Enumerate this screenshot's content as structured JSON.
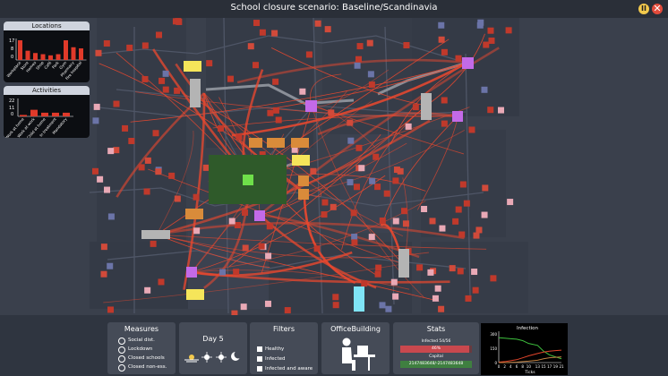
{
  "window": {
    "title": "School closure scenario: Baseline/Scandinavia",
    "pause_icon": "pause-icon",
    "close_icon": "close-icon"
  },
  "locations_chart": {
    "title": "Locations",
    "type": "bar",
    "yticks": [
      "17",
      "8",
      "0"
    ],
    "categories": [
      "Home",
      "Workplace",
      "School",
      "Daycare",
      "Bar",
      "Restaurant",
      "Shop",
      "Park",
      "Other"
    ],
    "display_labels": [
      "Workplace",
      "Store",
      "Homes",
      "Shop",
      "Café",
      "Park",
      "Gym",
      "Pharmacy",
      "Fire hospital"
    ],
    "values": [
      17,
      8,
      6,
      5,
      4,
      5,
      17,
      11,
      10
    ],
    "color": "#e03a2a",
    "ylim": [
      0,
      17
    ]
  },
  "activities_chart": {
    "title": "Activities",
    "type": "bar",
    "yticks": [
      "22",
      "11",
      "0"
    ],
    "categories": [
      "Work at home",
      "Work at work",
      "Child at home",
      "In treatment",
      "Mandatory"
    ],
    "values": [
      2,
      9,
      5,
      5,
      5
    ],
    "color": "#e03a2a",
    "ylim": [
      0,
      22
    ]
  },
  "measures": {
    "title": "Measures",
    "options": [
      "Social dist.",
      "Lockdown",
      "Closed schools",
      "Closed non-ess."
    ]
  },
  "day": {
    "label": "Day 5",
    "phase_icons": [
      "sunrise-icon",
      "sun-icon",
      "sun-icon",
      "moon-icon"
    ]
  },
  "filters": {
    "title": "Filters",
    "options": [
      "Healthy",
      "Infected",
      "Infected and aware"
    ]
  },
  "building": {
    "title": "OfficeBuilding",
    "icon": "office-worker-icon"
  },
  "stats": {
    "title": "Stats",
    "infected_label": "Infected 54/56",
    "bar_label": "46%",
    "capital_label": "Capital",
    "capital_value": "2147483648/-2147483648",
    "infected_fraction": 0.96,
    "colors": {
      "infected": "#c9484e",
      "capital": "#3f7f40"
    }
  },
  "infection_chart": {
    "title": "Infection",
    "type": "line",
    "x": [
      0,
      2,
      4,
      6,
      8,
      10,
      13,
      15,
      17,
      19,
      21
    ],
    "xticks": [
      "0",
      "2",
      "4",
      "6",
      "8",
      "10",
      "13",
      "15",
      "17",
      "19",
      "21"
    ],
    "yticks": [
      "300",
      "150",
      "0"
    ],
    "xlabel": "Ticks",
    "ylim": [
      0,
      300
    ],
    "series": [
      {
        "color": "#3ec13e",
        "values": [
          260,
          255,
          250,
          245,
          230,
          200,
          180,
          120,
          80,
          60,
          40
        ]
      },
      {
        "color": "#e2452b",
        "values": [
          5,
          10,
          20,
          30,
          50,
          70,
          95,
          110,
          120,
          125,
          130
        ]
      },
      {
        "color": "#c08040",
        "values": [
          0,
          0,
          2,
          5,
          10,
          15,
          25,
          40,
          50,
          55,
          60
        ]
      }
    ]
  }
}
